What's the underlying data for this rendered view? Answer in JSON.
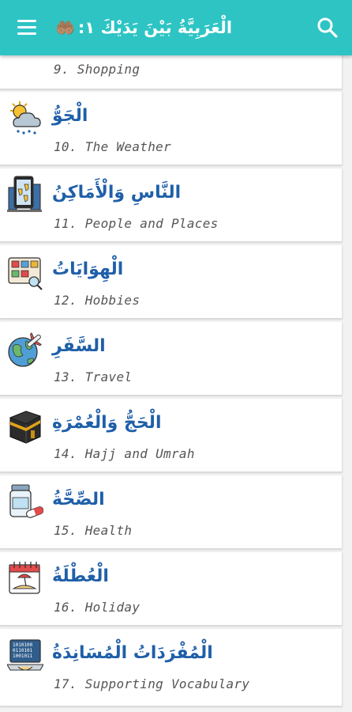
{
  "appbar": {
    "title": "الْعَرَبِيَّةُ بَيْنَ يَدَيْكَ ١:",
    "title_emoji": "🤲🏽",
    "menu_icon": "hamburger-menu-icon",
    "search_icon": "search-icon",
    "bg_color": "#2ec4c4"
  },
  "lessons": [
    {
      "arabic": "",
      "english": "9. Shopping",
      "icon": "shopping-icon"
    },
    {
      "arabic": "الْجَوُّ",
      "english": "10. The Weather",
      "icon": "weather-icon"
    },
    {
      "arabic": "النَّاسِ وَالْأَمَاكِنُ",
      "english": "11. People and Places",
      "icon": "city-map-icon"
    },
    {
      "arabic": "الْهِوَايَاتُ",
      "english": "12. Hobbies",
      "icon": "hobbies-icon"
    },
    {
      "arabic": "السَّفَرِ",
      "english": "13. Travel",
      "icon": "globe-plane-icon"
    },
    {
      "arabic": "الْحَجُّ وَالْعُمْرَةِ",
      "english": "14. Hajj and Umrah",
      "icon": "kaaba-icon"
    },
    {
      "arabic": "الصِّحَّةُ",
      "english": "15. Health",
      "icon": "medicine-icon"
    },
    {
      "arabic": "الْعُطْلَةُ",
      "english": "16. Holiday",
      "icon": "calendar-beach-icon"
    },
    {
      "arabic": "الْمُفْرَدَاتُ الْمُسَانِدَةُ",
      "english": "17. Supporting Vocabulary",
      "icon": "binary-laptop-icon"
    }
  ],
  "colors": {
    "arabic_text": "#1f5fa9",
    "english_text": "#555555",
    "card_bg": "#ffffff",
    "page_bg": "#f2f2f2"
  }
}
